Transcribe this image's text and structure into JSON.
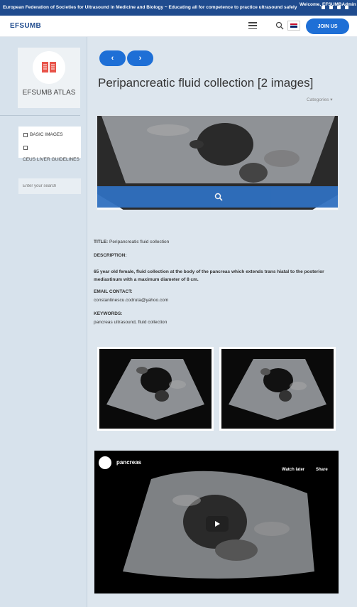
{
  "topbar": {
    "tagline": "European Federation of Societies for Ultrasound in Medicine and Biology ~ Educating all for competence to practice ultrasound safely",
    "welcome": "Welcome, EFSUMBAdmin"
  },
  "header": {
    "logo": "EFSUMB",
    "join_label": "JOIN US"
  },
  "sidebar": {
    "atlas_label": "EFSUMB ATLAS",
    "menu": [
      {
        "label": "BASIC IMAGES"
      },
      {
        "label": ""
      }
    ],
    "guidelines": "CEUS LIVER GUIDELINES",
    "search_placeholder": "Enter your search"
  },
  "main": {
    "prev_label": "‹",
    "next_label": "›",
    "title": "Peripancreatic fluid collection [2 images]",
    "categories_label": "Categories ▾"
  },
  "details": {
    "title_label": "TITLE:",
    "title_value": "Peripancreatic fluid collection",
    "description_label": "DESCRIPTION:",
    "description_text": "65 year old female, fluid collection at the body of the pancreas which extends trans hiatal to the posterior mediastinum with a maximum diameter of 8 cm.",
    "email_label": "EMAIL CONTACT:",
    "email_value": "constantinescu.codruta@yahoo.com",
    "keywords_label": "KEYWORDS:",
    "keywords_value": "pancreas ultrasound, fluid collection"
  },
  "video": {
    "title": "pancreas",
    "watch_later": "Watch later",
    "share": "Share"
  }
}
